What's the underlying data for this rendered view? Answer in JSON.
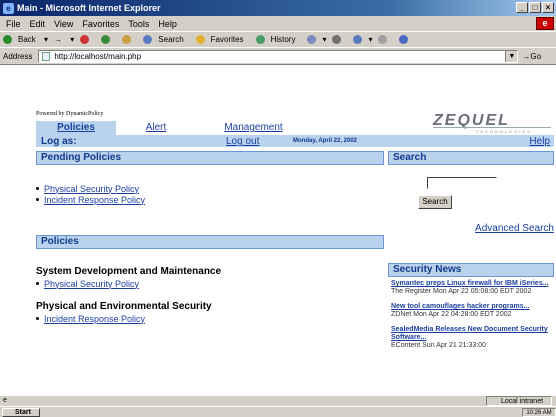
{
  "window": {
    "title": "Main - Microsoft Internet Explorer"
  },
  "menu": [
    "File",
    "Edit",
    "View",
    "Favorites",
    "Tools",
    "Help"
  ],
  "toolbar": {
    "back": "Back",
    "forward": "→",
    "search": "Search",
    "favorites": "Favorites",
    "history": "History"
  },
  "address": {
    "label": "Address",
    "url": "http://localhost/main.php",
    "go": "Go"
  },
  "page": {
    "powered": "Powered by DynamicPolicy",
    "logo": "ZEQUEL",
    "logo_sub": "TECHNOLOGIES",
    "nav": [
      {
        "label": "Policies"
      },
      {
        "label": "Alert"
      },
      {
        "label": "Management"
      }
    ],
    "logas": "Log as:",
    "logout": "Log out",
    "date": "Monday, April 22, 2002",
    "help": "Help"
  },
  "pending": {
    "title": "Pending Policies",
    "items": [
      "Physical Security Policy",
      "Incident Response Policy"
    ]
  },
  "policies": {
    "title": "Policies",
    "sections": [
      {
        "title": "System Development and Maintenance",
        "items": [
          "Physical Security Policy"
        ]
      },
      {
        "title": "Physical and Environmental Security",
        "items": [
          "Incident Response Policy"
        ]
      }
    ]
  },
  "search": {
    "title": "Search",
    "button": "Search",
    "advanced": "Advanced Search"
  },
  "news": {
    "title": "Security News",
    "items": [
      {
        "title": "Symantec preps Linux firewall for IBM iSeries...",
        "meta": "The Register Mon Apr 22 05:08:00 EDT 2002"
      },
      {
        "title": "New tool camouflages hacker programs...",
        "meta": "ZDNet Mon Apr 22 04:28:00 EDT 2002"
      },
      {
        "title": "SealedMedia Releases New Document Security Software...",
        "meta": "EContent Sun Apr 21 21:33:00"
      }
    ]
  },
  "status": {
    "zone": "Local intranet"
  },
  "taskbar": {
    "start": "Start",
    "clock": "10:26 AM"
  },
  "colors": {
    "accent": "#b9d2ee",
    "link": "#1a3fa0",
    "title_gradient": "#0a246a"
  }
}
